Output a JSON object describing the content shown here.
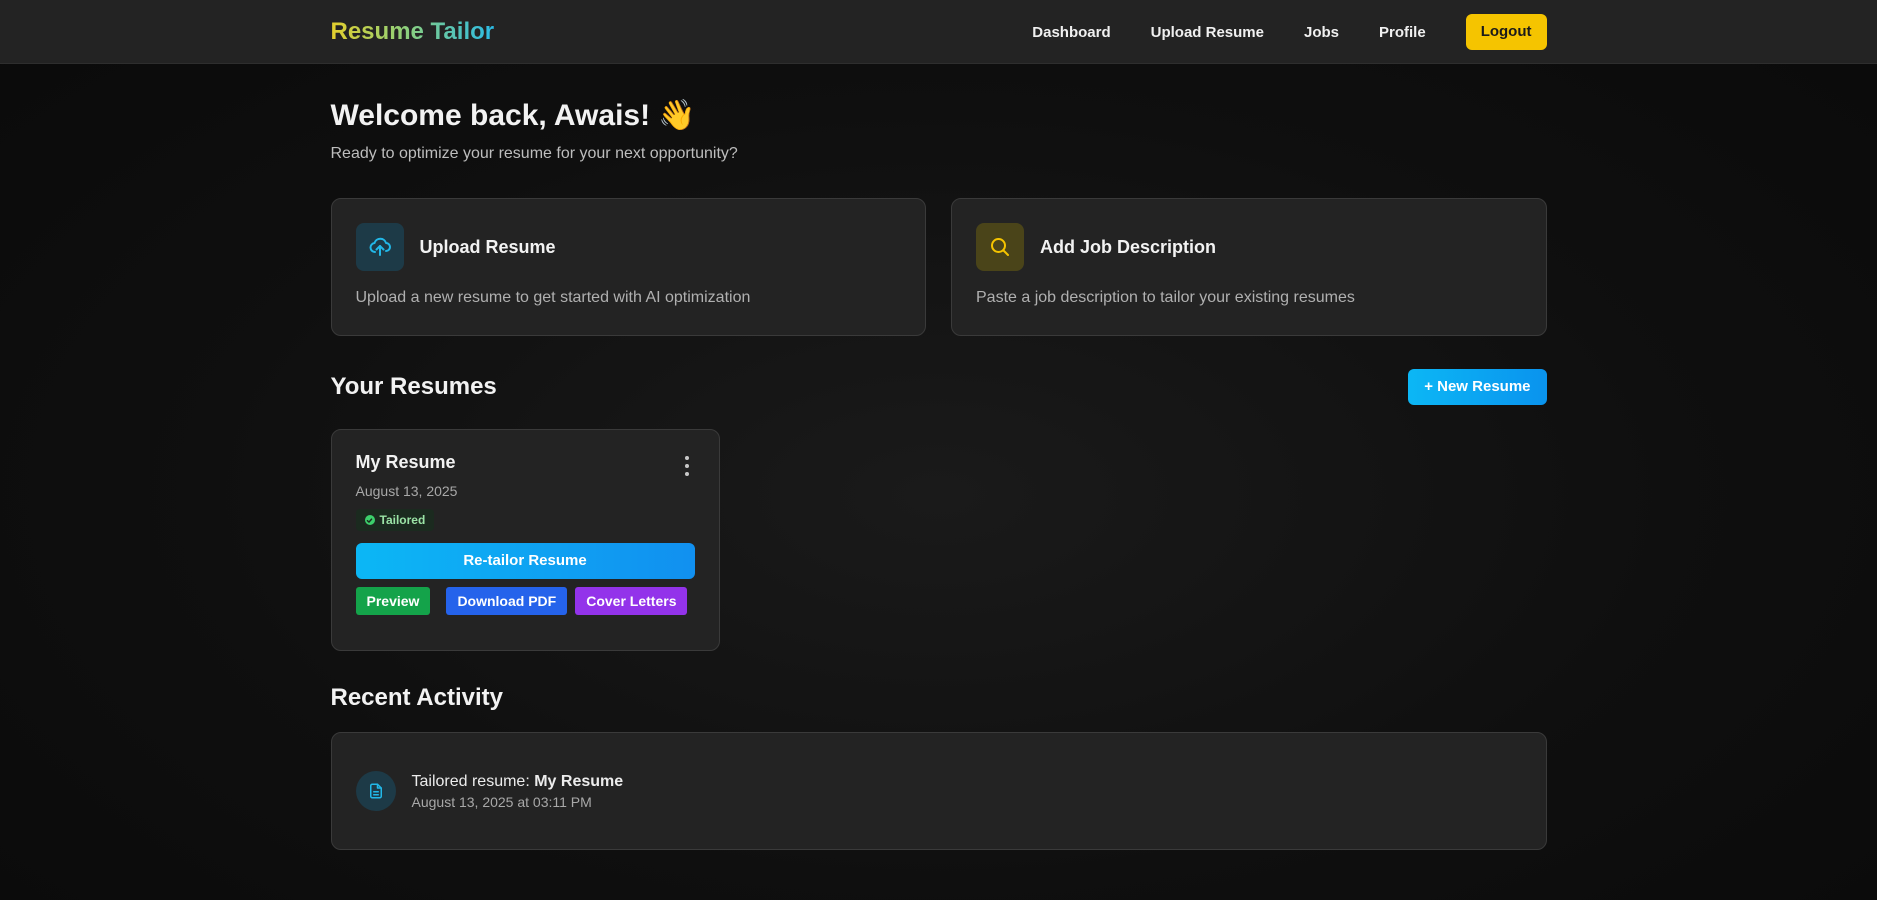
{
  "brand": {
    "name": "Resume Tailor"
  },
  "nav": {
    "links": [
      "Dashboard",
      "Upload Resume",
      "Jobs",
      "Profile"
    ],
    "logout_label": "Logout"
  },
  "welcome": {
    "title": "Welcome back, Awais! 👋",
    "subtitle": "Ready to optimize your resume for your next opportunity?"
  },
  "actions": [
    {
      "title": "Upload Resume",
      "description": "Upload a new resume to get started with AI optimization",
      "icon": "upload-cloud-icon",
      "color": "#22b8e8"
    },
    {
      "title": "Add Job Description",
      "description": "Paste a job description to tailor your existing resumes",
      "icon": "search-icon",
      "color": "#f5c400"
    }
  ],
  "resumes_section": {
    "title": "Your Resumes",
    "new_button_label": "+ New Resume",
    "items": [
      {
        "name": "My Resume",
        "date": "August 13, 2025",
        "status": "Tailored",
        "retailor_label": "Re-tailor Resume",
        "preview_label": "Preview",
        "download_label": "Download PDF",
        "cover_letters_label": "Cover Letters"
      }
    ]
  },
  "activity_section": {
    "title": "Recent Activity",
    "items": [
      {
        "prefix": "Tailored resume: ",
        "subject": "My Resume",
        "time": "August 13, 2025 at 03:11 PM"
      }
    ]
  },
  "colors": {
    "accent_blue": "#0cb7f5",
    "accent_yellow": "#f5c400",
    "success_green": "#14a34a",
    "link_blue": "#2563eb",
    "purple": "#9333ea"
  }
}
